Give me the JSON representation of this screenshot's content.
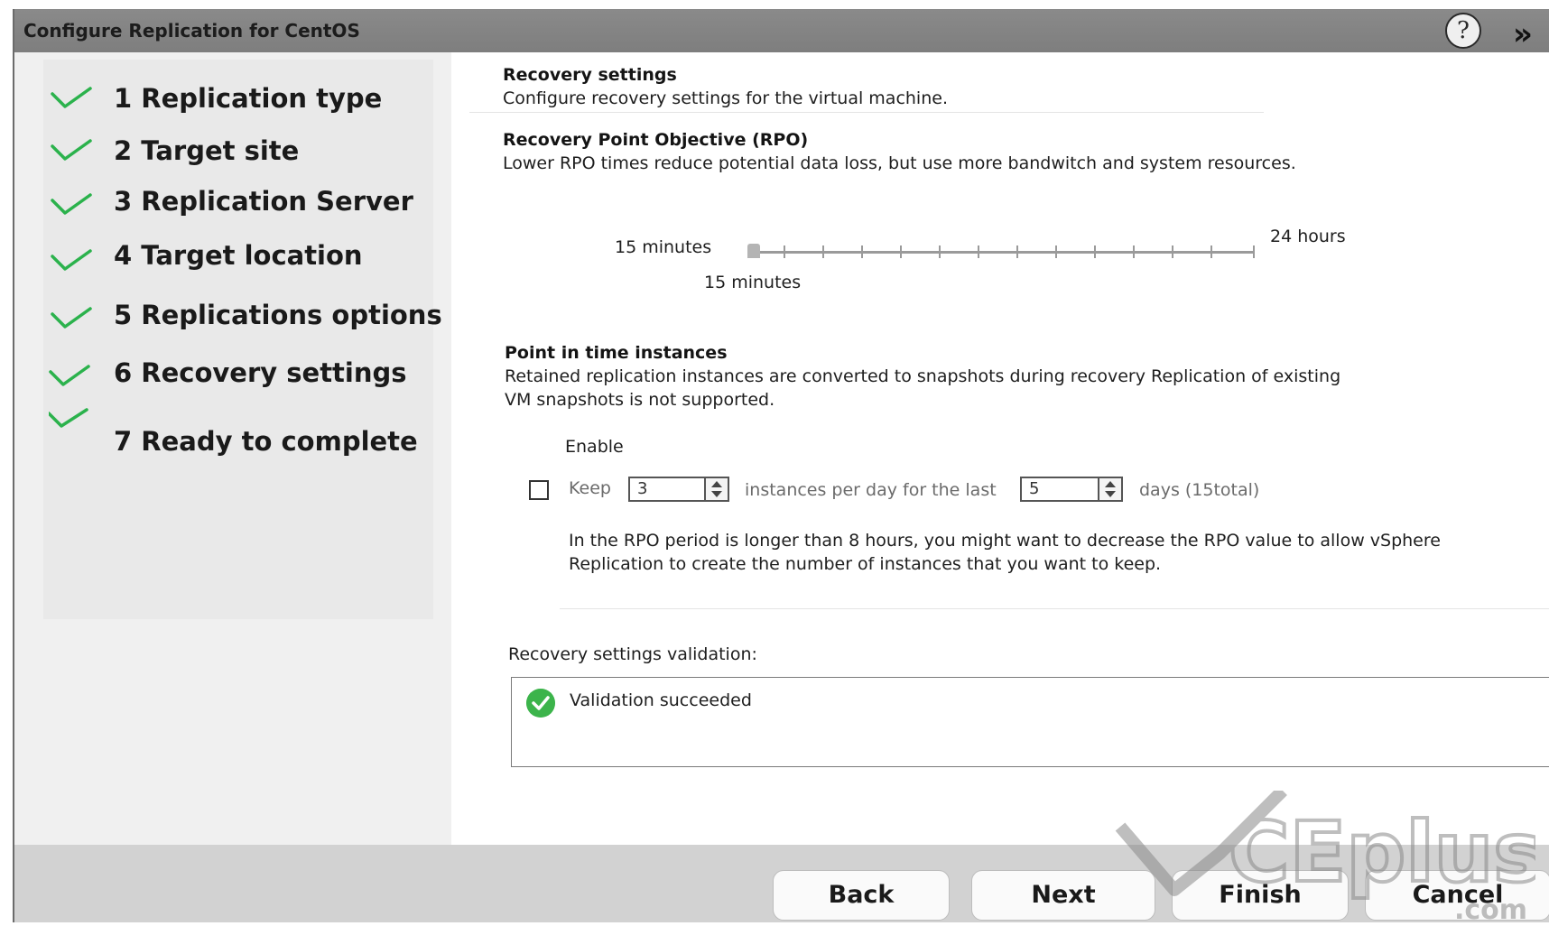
{
  "window": {
    "title": "Configure Replication for CentOS"
  },
  "help": {
    "glyph": "?"
  },
  "expand": {
    "glyph": "»"
  },
  "steps": [
    {
      "label": "1 Replication type",
      "icon": "check-icon"
    },
    {
      "label": "2 Target site",
      "icon": "check-icon"
    },
    {
      "label": "3 Replication Server",
      "icon": "check-icon"
    },
    {
      "label": "4 Target location",
      "icon": "check-icon"
    },
    {
      "label": "5 Replications options",
      "icon": "check-icon"
    },
    {
      "label": "6 Recovery settings",
      "icon": "check-icon"
    },
    {
      "label": "7 Ready to complete",
      "icon": "check-icon"
    }
  ],
  "recovery": {
    "heading": "Recovery settings",
    "description": "Configure recovery  settings for the virtual machine."
  },
  "rpo": {
    "heading": "Recovery Point Objective (RPO)",
    "description": "Lower RPO times reduce potential data loss, but use more bandwitch and system resources.",
    "min_label": "15 minutes",
    "max_label": "24 hours",
    "current_value": "15 minutes"
  },
  "pit": {
    "heading": "Point in time instances",
    "description_line1": "Retained  replication  instances  are  converted  to  snapshots  during  recovery  Replication  of  existing",
    "description_line2": "VM snapshots is not supported.",
    "enable_label": "Enable",
    "enabled": false,
    "keep_label": "Keep",
    "keep_value": "3",
    "instances_label": "instances per day for the last",
    "days_value": "5",
    "days_label": "days (15total)",
    "note_line1": "In  the  RPO  period  is  longer  than  8  hours,  you  might  want  to  decrease  the  RPO  value  to  allow  vSphere",
    "note_line2": "Replication to create the number of instances that you want to keep."
  },
  "validation": {
    "label": "Recovery settings validation:",
    "message": "Validation succeeded",
    "status_color": "#3cb44b"
  },
  "buttons": {
    "back": "Back",
    "next": "Next",
    "finish": "Finish",
    "cancel": "Cancel"
  },
  "watermark": {
    "text": "CEplus",
    "suffix": ".com"
  },
  "colors": {
    "check": "#2bb24c",
    "titlebar": "#858585",
    "footer": "#d2d2d2"
  }
}
